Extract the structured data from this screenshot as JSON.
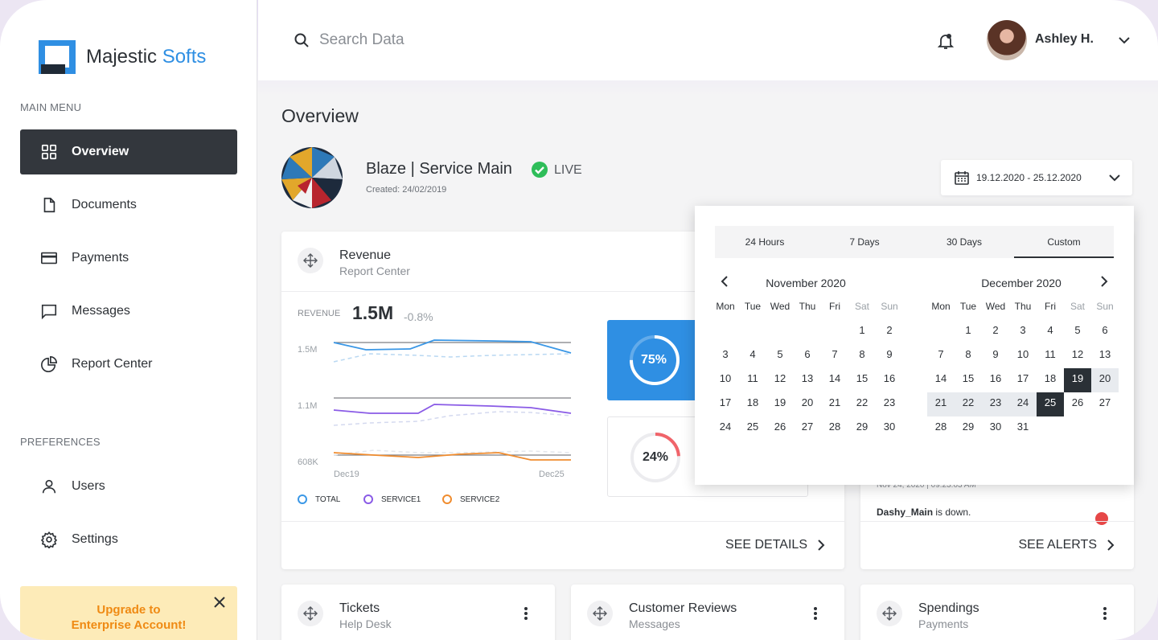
{
  "brand": {
    "name_part1": "Majestic",
    "name_part2": "Softs"
  },
  "sidebar": {
    "main_menu_label": "MAIN MENU",
    "items": [
      {
        "label": "Overview",
        "icon": "grid-icon",
        "active": true
      },
      {
        "label": "Documents",
        "icon": "document-icon"
      },
      {
        "label": "Payments",
        "icon": "credit-card-icon"
      },
      {
        "label": "Messages",
        "icon": "message-icon"
      },
      {
        "label": "Report Center",
        "icon": "pie-chart-icon"
      }
    ],
    "preferences_label": "PREFERENCES",
    "pref_items": [
      {
        "label": "Users",
        "icon": "user-icon"
      },
      {
        "label": "Settings",
        "icon": "gear-icon"
      }
    ],
    "upgrade": {
      "line1": "Upgrade to",
      "line2": "Enterprise Account!"
    }
  },
  "topbar": {
    "search_placeholder": "Search Data",
    "user_name": "Ashley H."
  },
  "page": {
    "title": "Overview",
    "service_name": "Blaze | Service Main",
    "service_status": "LIVE",
    "service_created": "Created: 24/02/2019",
    "date_range": "19.12.2020 - 25.12.2020"
  },
  "revenue_card": {
    "title": "Revenue",
    "subtitle": "Report Center",
    "metric_label": "REVENUE",
    "metric_value": "1.5M",
    "metric_change": "-0.8%",
    "y_labels": [
      "1.5M",
      "1.1M",
      "608K"
    ],
    "x_labels": [
      "Dec19",
      "Dec25"
    ],
    "legend": [
      "TOTAL",
      "SERVICE1",
      "SERVICE2"
    ],
    "stat1": {
      "value": 75,
      "label": "75%"
    },
    "stat2": {
      "value": 24,
      "label": "24%"
    },
    "footer_link": "SEE DETAILS"
  },
  "alerts_card": {
    "alert_time": "Nov 24, 2020 | 09:23:03 AM",
    "alert_source": "Dashy_Main",
    "alert_text": " is down.",
    "footer_link": "SEE ALERTS"
  },
  "bottom_cards": [
    {
      "title": "Tickets",
      "subtitle": "Help Desk"
    },
    {
      "title": "Customer Reviews",
      "subtitle": "Messages"
    },
    {
      "title": "Spendings",
      "subtitle": "Payments"
    }
  ],
  "calendar_popup": {
    "tabs": [
      "24 Hours",
      "7 Days",
      "30 Days",
      "Custom"
    ],
    "active_tab": "Custom",
    "weekdays": [
      "Mon",
      "Tue",
      "Wed",
      "Thu",
      "Fri",
      "Sat",
      "Sun"
    ],
    "left_month": "November 2020",
    "right_month": "December 2020",
    "selected_start": 19,
    "selected_end": 25
  },
  "colors": {
    "accent": "#2f8fe3",
    "dark": "#33373d",
    "total": "#3a97e6",
    "service1": "#8a5be6",
    "service2": "#f08c2e",
    "live": "#2ebd59",
    "upgrade_text": "#ef8a13"
  }
}
